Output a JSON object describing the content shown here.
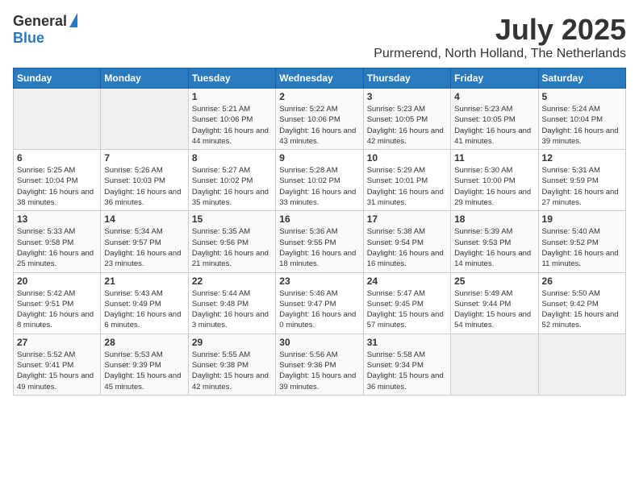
{
  "header": {
    "logo_general": "General",
    "logo_blue": "Blue",
    "month": "July 2025",
    "location": "Purmerend, North Holland, The Netherlands"
  },
  "weekdays": [
    "Sunday",
    "Monday",
    "Tuesday",
    "Wednesday",
    "Thursday",
    "Friday",
    "Saturday"
  ],
  "weeks": [
    [
      {
        "day": "",
        "sunrise": "",
        "sunset": "",
        "daylight": ""
      },
      {
        "day": "",
        "sunrise": "",
        "sunset": "",
        "daylight": ""
      },
      {
        "day": "1",
        "sunrise": "Sunrise: 5:21 AM",
        "sunset": "Sunset: 10:06 PM",
        "daylight": "Daylight: 16 hours and 44 minutes."
      },
      {
        "day": "2",
        "sunrise": "Sunrise: 5:22 AM",
        "sunset": "Sunset: 10:06 PM",
        "daylight": "Daylight: 16 hours and 43 minutes."
      },
      {
        "day": "3",
        "sunrise": "Sunrise: 5:23 AM",
        "sunset": "Sunset: 10:05 PM",
        "daylight": "Daylight: 16 hours and 42 minutes."
      },
      {
        "day": "4",
        "sunrise": "Sunrise: 5:23 AM",
        "sunset": "Sunset: 10:05 PM",
        "daylight": "Daylight: 16 hours and 41 minutes."
      },
      {
        "day": "5",
        "sunrise": "Sunrise: 5:24 AM",
        "sunset": "Sunset: 10:04 PM",
        "daylight": "Daylight: 16 hours and 39 minutes."
      }
    ],
    [
      {
        "day": "6",
        "sunrise": "Sunrise: 5:25 AM",
        "sunset": "Sunset: 10:04 PM",
        "daylight": "Daylight: 16 hours and 38 minutes."
      },
      {
        "day": "7",
        "sunrise": "Sunrise: 5:26 AM",
        "sunset": "Sunset: 10:03 PM",
        "daylight": "Daylight: 16 hours and 36 minutes."
      },
      {
        "day": "8",
        "sunrise": "Sunrise: 5:27 AM",
        "sunset": "Sunset: 10:02 PM",
        "daylight": "Daylight: 16 hours and 35 minutes."
      },
      {
        "day": "9",
        "sunrise": "Sunrise: 5:28 AM",
        "sunset": "Sunset: 10:02 PM",
        "daylight": "Daylight: 16 hours and 33 minutes."
      },
      {
        "day": "10",
        "sunrise": "Sunrise: 5:29 AM",
        "sunset": "Sunset: 10:01 PM",
        "daylight": "Daylight: 16 hours and 31 minutes."
      },
      {
        "day": "11",
        "sunrise": "Sunrise: 5:30 AM",
        "sunset": "Sunset: 10:00 PM",
        "daylight": "Daylight: 16 hours and 29 minutes."
      },
      {
        "day": "12",
        "sunrise": "Sunrise: 5:31 AM",
        "sunset": "Sunset: 9:59 PM",
        "daylight": "Daylight: 16 hours and 27 minutes."
      }
    ],
    [
      {
        "day": "13",
        "sunrise": "Sunrise: 5:33 AM",
        "sunset": "Sunset: 9:58 PM",
        "daylight": "Daylight: 16 hours and 25 minutes."
      },
      {
        "day": "14",
        "sunrise": "Sunrise: 5:34 AM",
        "sunset": "Sunset: 9:57 PM",
        "daylight": "Daylight: 16 hours and 23 minutes."
      },
      {
        "day": "15",
        "sunrise": "Sunrise: 5:35 AM",
        "sunset": "Sunset: 9:56 PM",
        "daylight": "Daylight: 16 hours and 21 minutes."
      },
      {
        "day": "16",
        "sunrise": "Sunrise: 5:36 AM",
        "sunset": "Sunset: 9:55 PM",
        "daylight": "Daylight: 16 hours and 18 minutes."
      },
      {
        "day": "17",
        "sunrise": "Sunrise: 5:38 AM",
        "sunset": "Sunset: 9:54 PM",
        "daylight": "Daylight: 16 hours and 16 minutes."
      },
      {
        "day": "18",
        "sunrise": "Sunrise: 5:39 AM",
        "sunset": "Sunset: 9:53 PM",
        "daylight": "Daylight: 16 hours and 14 minutes."
      },
      {
        "day": "19",
        "sunrise": "Sunrise: 5:40 AM",
        "sunset": "Sunset: 9:52 PM",
        "daylight": "Daylight: 16 hours and 11 minutes."
      }
    ],
    [
      {
        "day": "20",
        "sunrise": "Sunrise: 5:42 AM",
        "sunset": "Sunset: 9:51 PM",
        "daylight": "Daylight: 16 hours and 8 minutes."
      },
      {
        "day": "21",
        "sunrise": "Sunrise: 5:43 AM",
        "sunset": "Sunset: 9:49 PM",
        "daylight": "Daylight: 16 hours and 6 minutes."
      },
      {
        "day": "22",
        "sunrise": "Sunrise: 5:44 AM",
        "sunset": "Sunset: 9:48 PM",
        "daylight": "Daylight: 16 hours and 3 minutes."
      },
      {
        "day": "23",
        "sunrise": "Sunrise: 5:46 AM",
        "sunset": "Sunset: 9:47 PM",
        "daylight": "Daylight: 16 hours and 0 minutes."
      },
      {
        "day": "24",
        "sunrise": "Sunrise: 5:47 AM",
        "sunset": "Sunset: 9:45 PM",
        "daylight": "Daylight: 15 hours and 57 minutes."
      },
      {
        "day": "25",
        "sunrise": "Sunrise: 5:49 AM",
        "sunset": "Sunset: 9:44 PM",
        "daylight": "Daylight: 15 hours and 54 minutes."
      },
      {
        "day": "26",
        "sunrise": "Sunrise: 5:50 AM",
        "sunset": "Sunset: 9:42 PM",
        "daylight": "Daylight: 15 hours and 52 minutes."
      }
    ],
    [
      {
        "day": "27",
        "sunrise": "Sunrise: 5:52 AM",
        "sunset": "Sunset: 9:41 PM",
        "daylight": "Daylight: 15 hours and 49 minutes."
      },
      {
        "day": "28",
        "sunrise": "Sunrise: 5:53 AM",
        "sunset": "Sunset: 9:39 PM",
        "daylight": "Daylight: 15 hours and 45 minutes."
      },
      {
        "day": "29",
        "sunrise": "Sunrise: 5:55 AM",
        "sunset": "Sunset: 9:38 PM",
        "daylight": "Daylight: 15 hours and 42 minutes."
      },
      {
        "day": "30",
        "sunrise": "Sunrise: 5:56 AM",
        "sunset": "Sunset: 9:36 PM",
        "daylight": "Daylight: 15 hours and 39 minutes."
      },
      {
        "day": "31",
        "sunrise": "Sunrise: 5:58 AM",
        "sunset": "Sunset: 9:34 PM",
        "daylight": "Daylight: 15 hours and 36 minutes."
      },
      {
        "day": "",
        "sunrise": "",
        "sunset": "",
        "daylight": ""
      },
      {
        "day": "",
        "sunrise": "",
        "sunset": "",
        "daylight": ""
      }
    ]
  ]
}
